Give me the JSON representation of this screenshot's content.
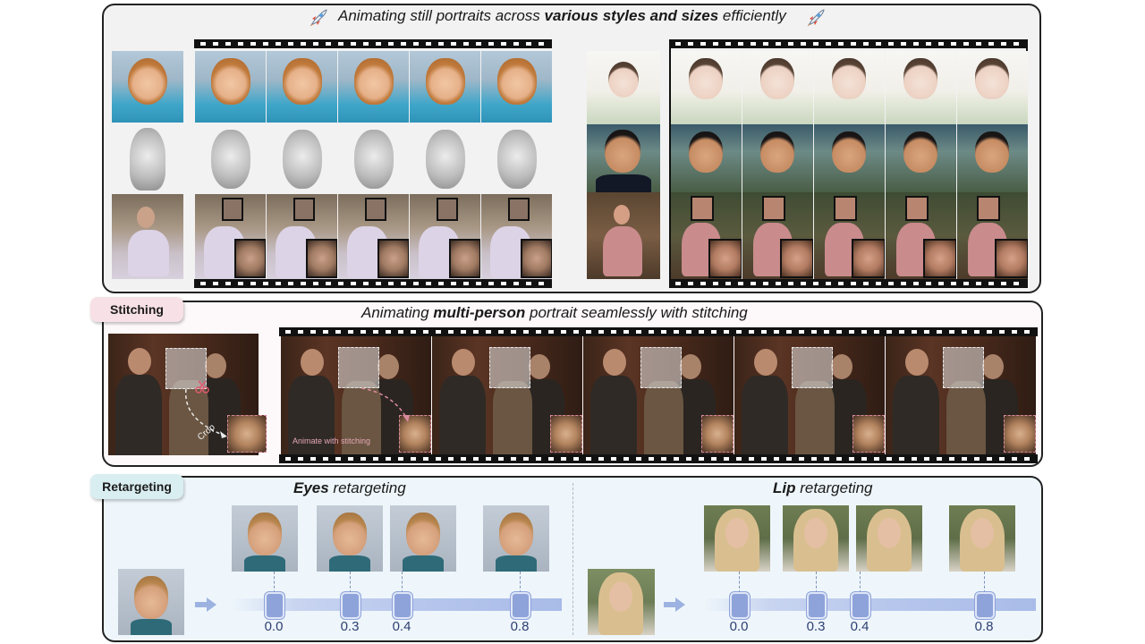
{
  "panels": {
    "top": {
      "title_pre": "Animating still portraits across ",
      "title_bold": "various styles and sizes",
      "title_post": " efficiently"
    },
    "stitching": {
      "tag": "Stitching",
      "title_pre": "Animating ",
      "title_bold": "multi-person",
      "title_post": " portrait seamlessly with stitching",
      "crop_label": "Crop",
      "animate_label": "Animate with stitching"
    },
    "retargeting": {
      "tag": "Retargeting",
      "eyes_bold": "Eyes",
      "eyes_rest": " retargeting",
      "lip_bold": "Lip",
      "lip_rest": " retargeting",
      "eyes_values": [
        "0.0",
        "0.3",
        "0.4",
        "0.8"
      ],
      "lip_values": [
        "0.0",
        "0.3",
        "0.4",
        "0.8"
      ]
    }
  },
  "icons": {
    "rocket": "rocket-icon",
    "arrow": "right-arrow-icon",
    "scissors": "scissors-icon"
  },
  "colors": {
    "stitching_tag_bg": "#f7e0e6",
    "stitching_panel_bg": "#fdf8fa",
    "retarget_tag_bg": "#d9eef1",
    "retarget_panel_bg": "#eef6fb",
    "slider_fill": "#8ea3da",
    "crop_dashed": "#d88a9c"
  }
}
